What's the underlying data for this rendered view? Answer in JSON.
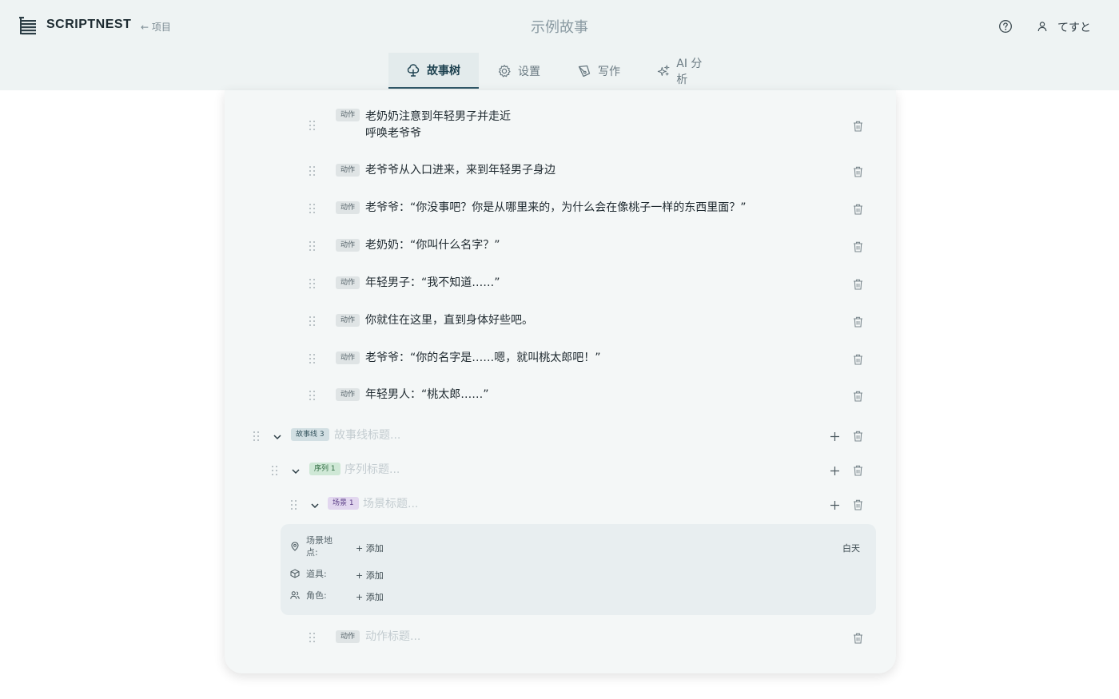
{
  "header": {
    "brand": "SCRIPTNEST",
    "back_label": "← 项目",
    "title": "示例故事",
    "user_name": "てすと"
  },
  "tabs": [
    {
      "label": "故事树",
      "icon": "tree-icon",
      "active": true
    },
    {
      "label": "设置",
      "icon": "gear-icon",
      "active": false
    },
    {
      "label": "写作",
      "icon": "pen-icon",
      "active": false
    },
    {
      "label": "AI 分析",
      "icon": "sparkle-icon",
      "active": false
    }
  ],
  "actions": [
    {
      "tag": "动作",
      "text": "老奶奶注意到年轻男子并走近",
      "text2": "呼唤老爷爷"
    },
    {
      "tag": "动作",
      "text": "老爷爷从入口进来，来到年轻男子身边"
    },
    {
      "tag": "动作",
      "text": "老爷爷：“你没事吧？你是从哪里来的，为什么会在像桃子一样的东西里面？”"
    },
    {
      "tag": "动作",
      "text": "老奶奶：“你叫什么名字？”"
    },
    {
      "tag": "动作",
      "text": "年轻男子：“我不知道……”"
    },
    {
      "tag": "动作",
      "text": "你就住在这里，直到身体好些吧。"
    },
    {
      "tag": "动作",
      "text": "老爷爷：“你的名字是……嗯，就叫桃太郎吧！”"
    },
    {
      "tag": "动作",
      "text": "年轻男人：“桃太郎……”"
    }
  ],
  "storyline": {
    "tag": "故事线 3",
    "placeholder": "故事线标题..."
  },
  "sequence": {
    "tag": "序列 1",
    "placeholder": "序列标题..."
  },
  "scene": {
    "tag": "场景 1",
    "placeholder": "场景标题...",
    "location_label_1": "场景地",
    "location_label_2": "点:",
    "props_label": "道具:",
    "characters_label": "角色:",
    "add_label": "+ 添加",
    "time_of_day": "白天"
  },
  "new_action": {
    "tag": "动作",
    "placeholder": "动作标题..."
  }
}
